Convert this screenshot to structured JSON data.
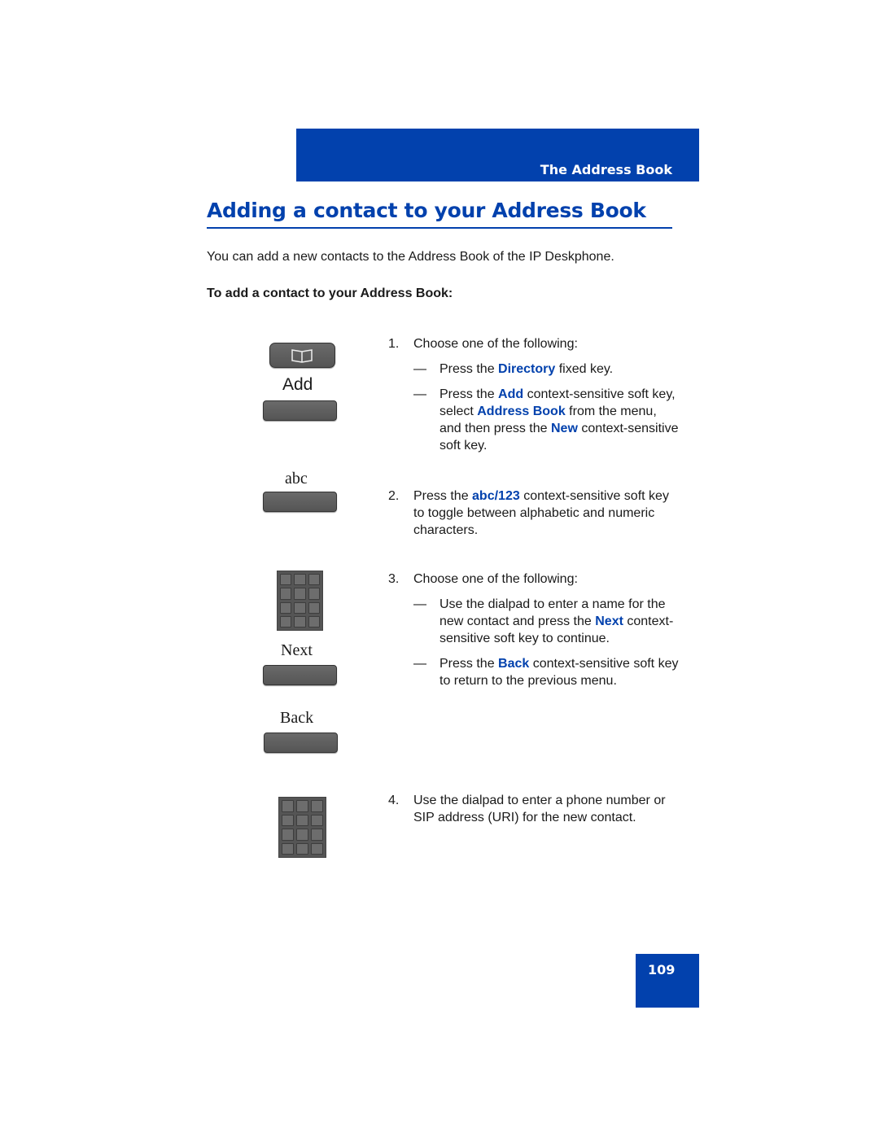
{
  "header": {
    "section": "The Address Book"
  },
  "title": "Adding a contact to your Address Book",
  "intro": "You can add a new contacts to the Address Book of the IP Deskphone.",
  "procedure_heading": "To add a contact to your Address Book:",
  "keys": {
    "add": "Add",
    "abc": "abc",
    "next": "Next",
    "back": "Back"
  },
  "steps": [
    {
      "num": "1.",
      "text": "Choose one of the following:",
      "subs": [
        {
          "dash": "—",
          "a": "Press the ",
          "b": "Directory",
          "c": " fixed key."
        },
        {
          "dash": "—",
          "a": "Press the ",
          "b": "Add",
          "c": " context-sensitive soft key, select ",
          "d": "Address Book",
          "e": " from the menu, and then press the ",
          "f": "New",
          "g": " context-sensitive soft key."
        }
      ]
    },
    {
      "num": "2.",
      "a": "Press the ",
      "b": "abc/123",
      "c": " context-sensitive soft key to toggle between alphabetic and numeric characters."
    },
    {
      "num": "3.",
      "text": "Choose one of the following:",
      "subs": [
        {
          "dash": "—",
          "a": "Use the dialpad to enter a name for the new contact and press the ",
          "b": "Next",
          "c": " context-sensitive soft key to continue."
        },
        {
          "dash": "—",
          "a": "Press the ",
          "b": "Back",
          "c": " context-sensitive soft key to return to the previous menu."
        }
      ]
    },
    {
      "num": "4.",
      "text": "Use the dialpad to enter a phone number or SIP address (URI) for the new contact."
    }
  ],
  "page_number": "109"
}
